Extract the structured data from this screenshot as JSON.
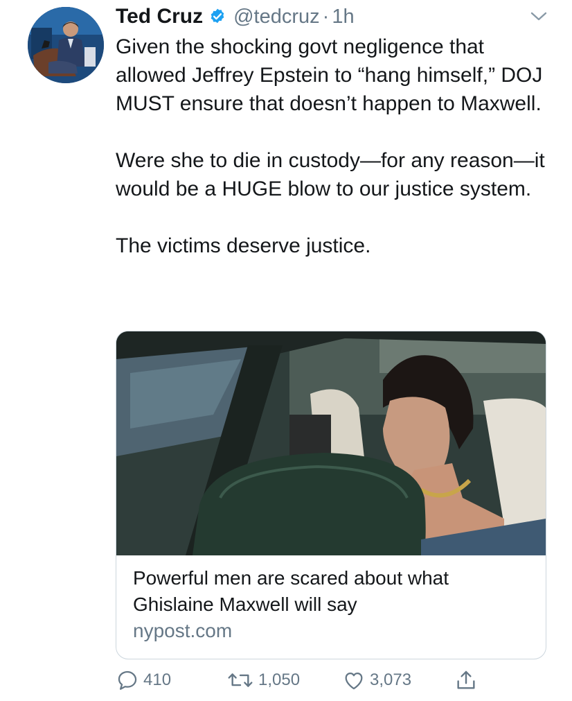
{
  "author": {
    "name": "Ted Cruz",
    "handle": "@tedcruz",
    "separator": "·",
    "time": "1h",
    "verified": true,
    "verified_icon": "verified-badge-icon",
    "avatar": "profile-photo"
  },
  "tweet": {
    "paragraphs": [
      "Given the shocking govt negligence that allowed Jeffrey Epstein to “hang himself,” DOJ MUST ensure that doesn’t happen to Maxwell.",
      "Were she to die in custody—for any reason—it would be a HUGE blow to our justice system.",
      "The victims deserve justice."
    ]
  },
  "card": {
    "image": "photo-woman-in-car",
    "title": "Powerful men are scared about what Ghislaine Maxwell will say",
    "domain": "nypost.com"
  },
  "actions": {
    "reply": {
      "icon": "reply-icon",
      "count": "410"
    },
    "retweet": {
      "icon": "retweet-icon",
      "count": "1,050"
    },
    "like": {
      "icon": "heart-icon",
      "count": "3,073"
    },
    "share": {
      "icon": "share-icon"
    }
  },
  "colors": {
    "text": "#14171a",
    "secondary": "#657786",
    "verified": "#1da1f2",
    "border": "#ccd6dd"
  }
}
